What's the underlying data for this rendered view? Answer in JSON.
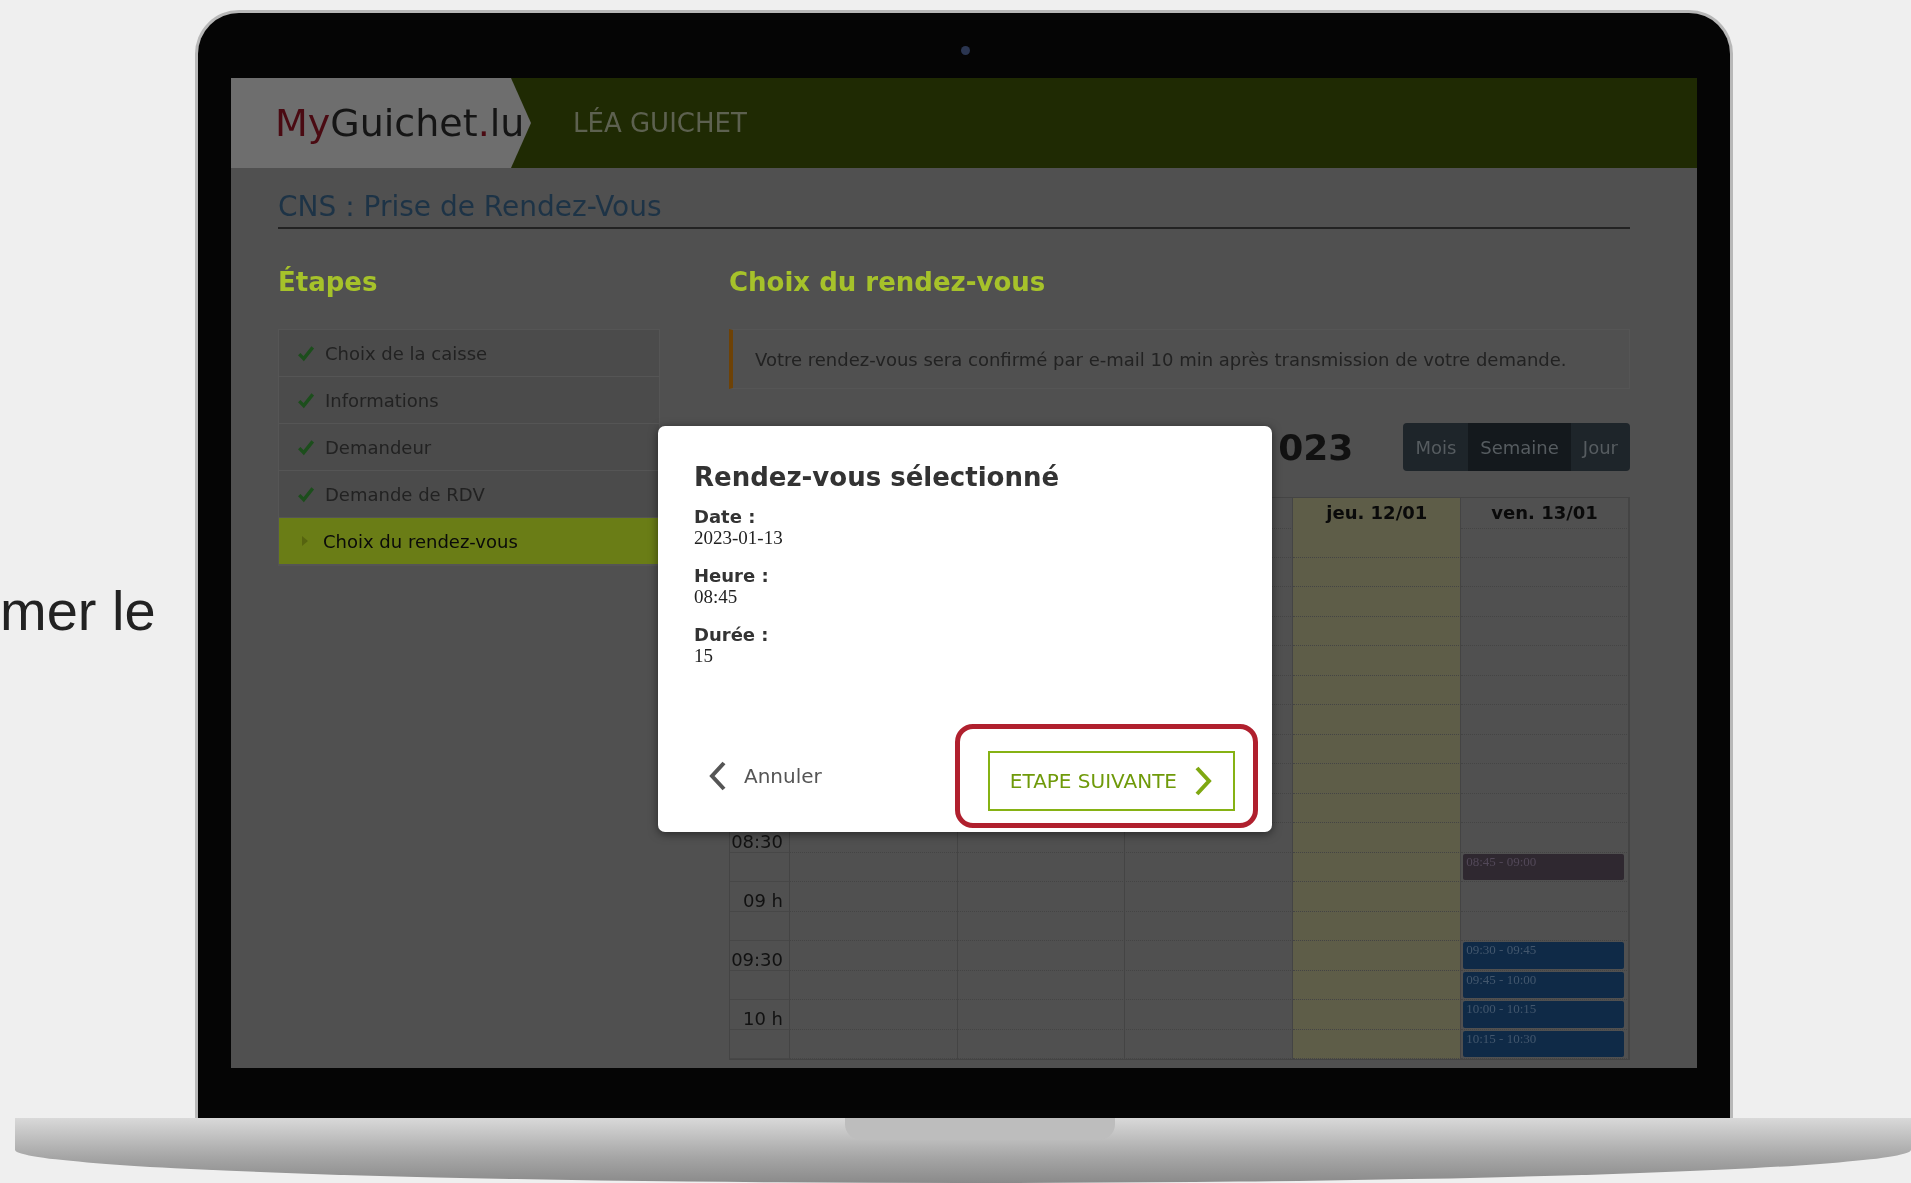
{
  "caption": "mer le",
  "header": {
    "logo": [
      {
        "text": "My",
        "kind": "accent"
      },
      {
        "text": "Guichet",
        "kind": "plain"
      },
      {
        "text": ".",
        "kind": "accent"
      },
      {
        "text": "lu",
        "kind": "plain"
      }
    ],
    "user": "LÉA GUICHET"
  },
  "page_title": "CNS : Prise de Rendez-Vous",
  "sidebar": {
    "title": "Étapes",
    "steps": [
      {
        "label": "Choix de la caisse",
        "done": true,
        "selected": false
      },
      {
        "label": "Informations",
        "done": true,
        "selected": false
      },
      {
        "label": "Demandeur",
        "done": true,
        "selected": false
      },
      {
        "label": "Demande de RDV",
        "done": true,
        "selected": false
      },
      {
        "label": "Choix du rendez-vous",
        "done": false,
        "selected": true
      }
    ]
  },
  "main": {
    "title": "Choix du rendez-vous",
    "notice": "Votre rendez-vous sera confirmé par e-mail 10 min après transmission de votre demande."
  },
  "calendar": {
    "title": "023",
    "views": [
      {
        "label": "Mois",
        "selected": false
      },
      {
        "label": "Semaine",
        "selected": true
      },
      {
        "label": "Jour",
        "selected": false
      }
    ],
    "days": [
      {
        "label": "jeu. 12/01",
        "today": true
      },
      {
        "label": "ven. 13/01",
        "today": false
      }
    ],
    "rows": [
      {},
      {},
      {},
      {},
      {},
      {},
      {},
      {},
      {},
      {},
      {
        "time": "08:30"
      },
      {
        "event": {
          "text": "08:45 - 09:00",
          "kind": "taken"
        }
      },
      {
        "time": "09 h"
      },
      {},
      {
        "time": "09:30",
        "event": {
          "text": "09:30 - 09:45",
          "kind": "free"
        }
      },
      {
        "event": {
          "text": "09:45 - 10:00",
          "kind": "free"
        }
      },
      {
        "time": "10 h",
        "event": {
          "text": "10:00 - 10:15",
          "kind": "free"
        }
      },
      {
        "event": {
          "text": "10:15 - 10:30",
          "kind": "free"
        }
      }
    ]
  },
  "modal": {
    "title": "Rendez-vous sélectionné",
    "fields": [
      {
        "label": "Date :",
        "value": "2023-01-13"
      },
      {
        "label": "Heure :",
        "value": "08:45"
      },
      {
        "label": "Durée :",
        "value": "15"
      }
    ],
    "cancel": "Annuler",
    "next": "ETAPE SUIVANTE",
    "next_highlighted": true
  }
}
